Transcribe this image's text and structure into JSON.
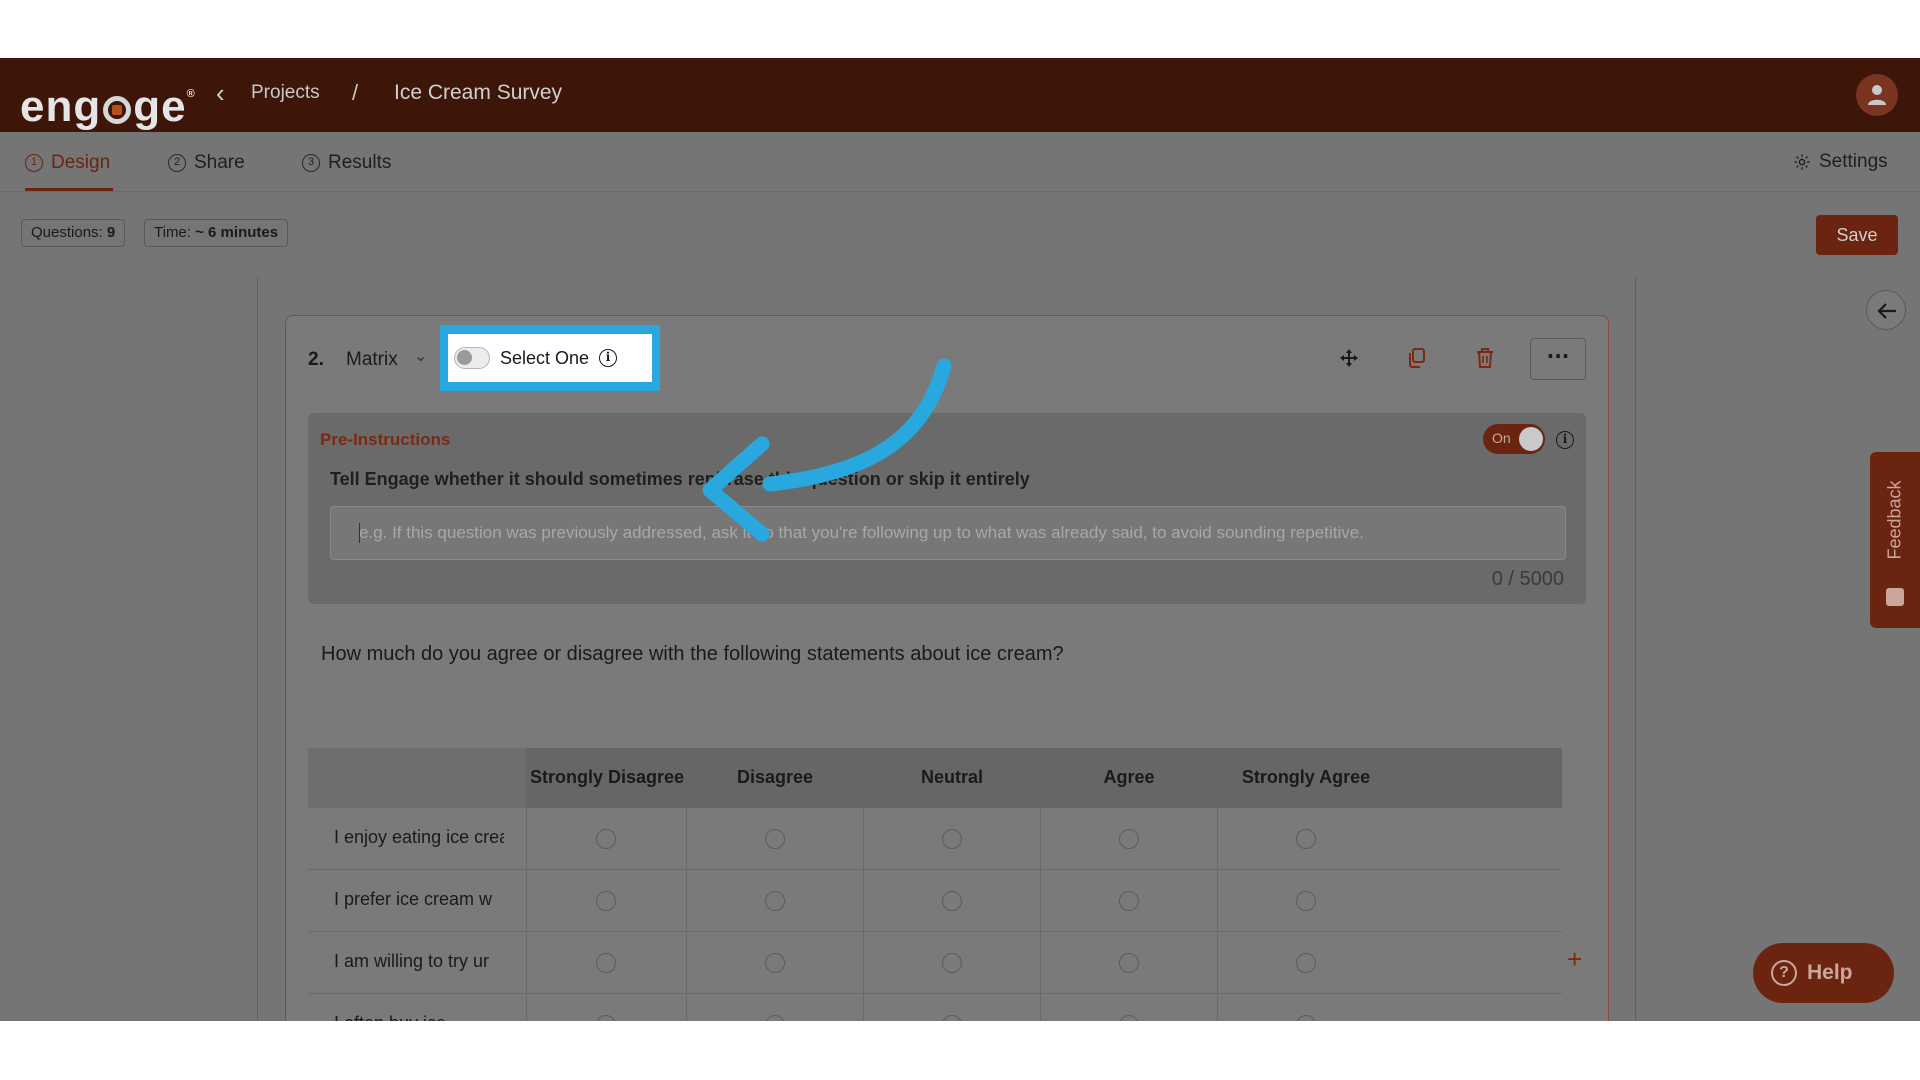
{
  "header": {
    "logo_text": "engage",
    "breadcrumb_back": "‹",
    "breadcrumb_projects": "Projects",
    "breadcrumb_separator": "/",
    "project_title": "Ice Cream Survey"
  },
  "tabs": [
    {
      "num": "1",
      "label": "Design",
      "active": true
    },
    {
      "num": "2",
      "label": "Share"
    },
    {
      "num": "3",
      "label": "Results"
    }
  ],
  "settings_label": "Settings",
  "meta": {
    "questions_label": "Questions:",
    "questions_value": "9",
    "time_label": "Time:",
    "time_value": "~ 6 minutes",
    "save_label": "Save"
  },
  "question": {
    "number": "2.",
    "type": "Matrix",
    "select_one_label": "Select One",
    "more_label": "···",
    "text": "How much do you agree or disagree with the following statements about ice cream?"
  },
  "pre_instructions": {
    "title": "Pre-Instructions",
    "toggle_label": "On",
    "description": "Tell Engage whether it should sometimes rephrase this question or skip it entirely",
    "placeholder": "e.g. If this question was previously addressed, ask it so that you're following up to what was already said, to avoid sounding repetitive.",
    "count": "0 / 5000"
  },
  "matrix": {
    "columns": [
      "Strongly Disagree",
      "Disagree",
      "Neutral",
      "Agree",
      "Strongly Agree"
    ],
    "rows": [
      "I enjoy eating ice cream",
      "I prefer ice cream w",
      "I am willing to try ur",
      "I often buy ice"
    ],
    "add_label": "+"
  },
  "side": {
    "feedback_label": "Feedback",
    "help_label": "Help",
    "help_icon": "?"
  },
  "colors": {
    "brand": "#6b2410",
    "header_bg": "#3d1509",
    "highlight": "#29a8e0"
  }
}
